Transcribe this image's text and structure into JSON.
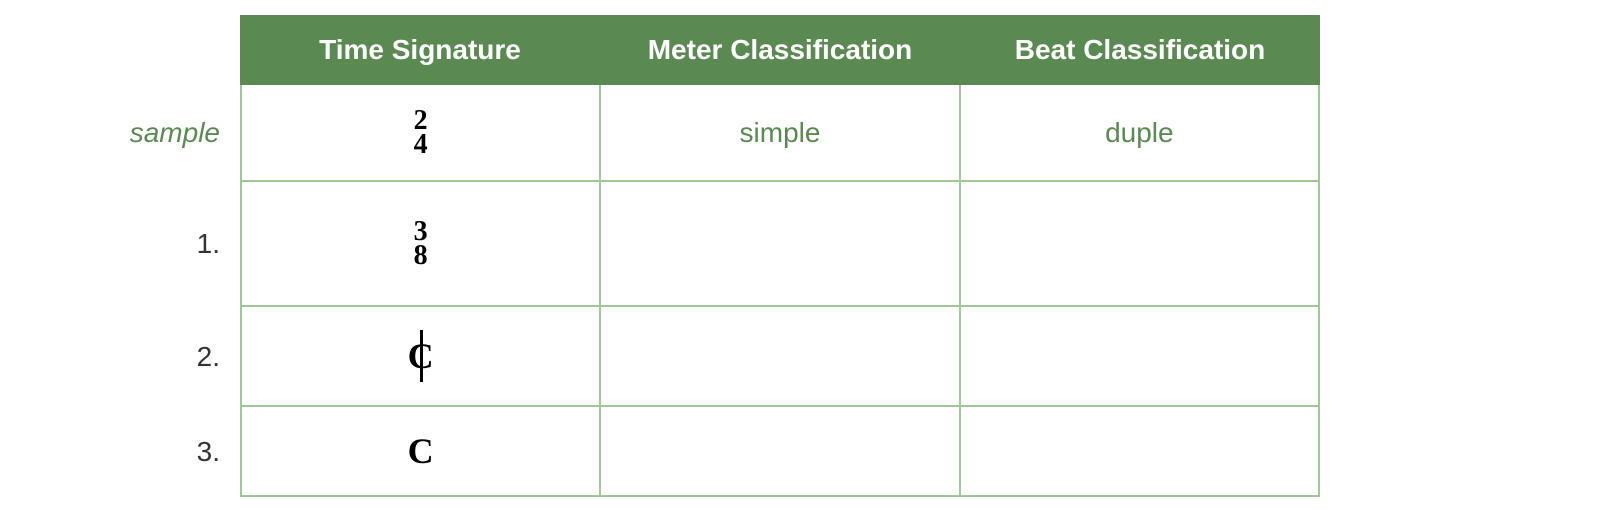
{
  "headers": {
    "time_signature": "Time Signature",
    "meter_classification": "Meter Classification",
    "beat_classification": "Beat Classification"
  },
  "rows": {
    "sample": {
      "label": "sample",
      "time_sig_top": "2",
      "time_sig_bottom": "4",
      "meter": "simple",
      "beat": "duple"
    },
    "row1": {
      "label": "1.",
      "time_sig_top": "3",
      "time_sig_bottom": "8",
      "meter": "",
      "beat": ""
    },
    "row2": {
      "label": "2.",
      "time_symbol": "C",
      "time_symbol_type": "cut",
      "meter": "",
      "beat": ""
    },
    "row3": {
      "label": "3.",
      "time_symbol": "C",
      "time_symbol_type": "common",
      "meter": "",
      "beat": ""
    }
  }
}
